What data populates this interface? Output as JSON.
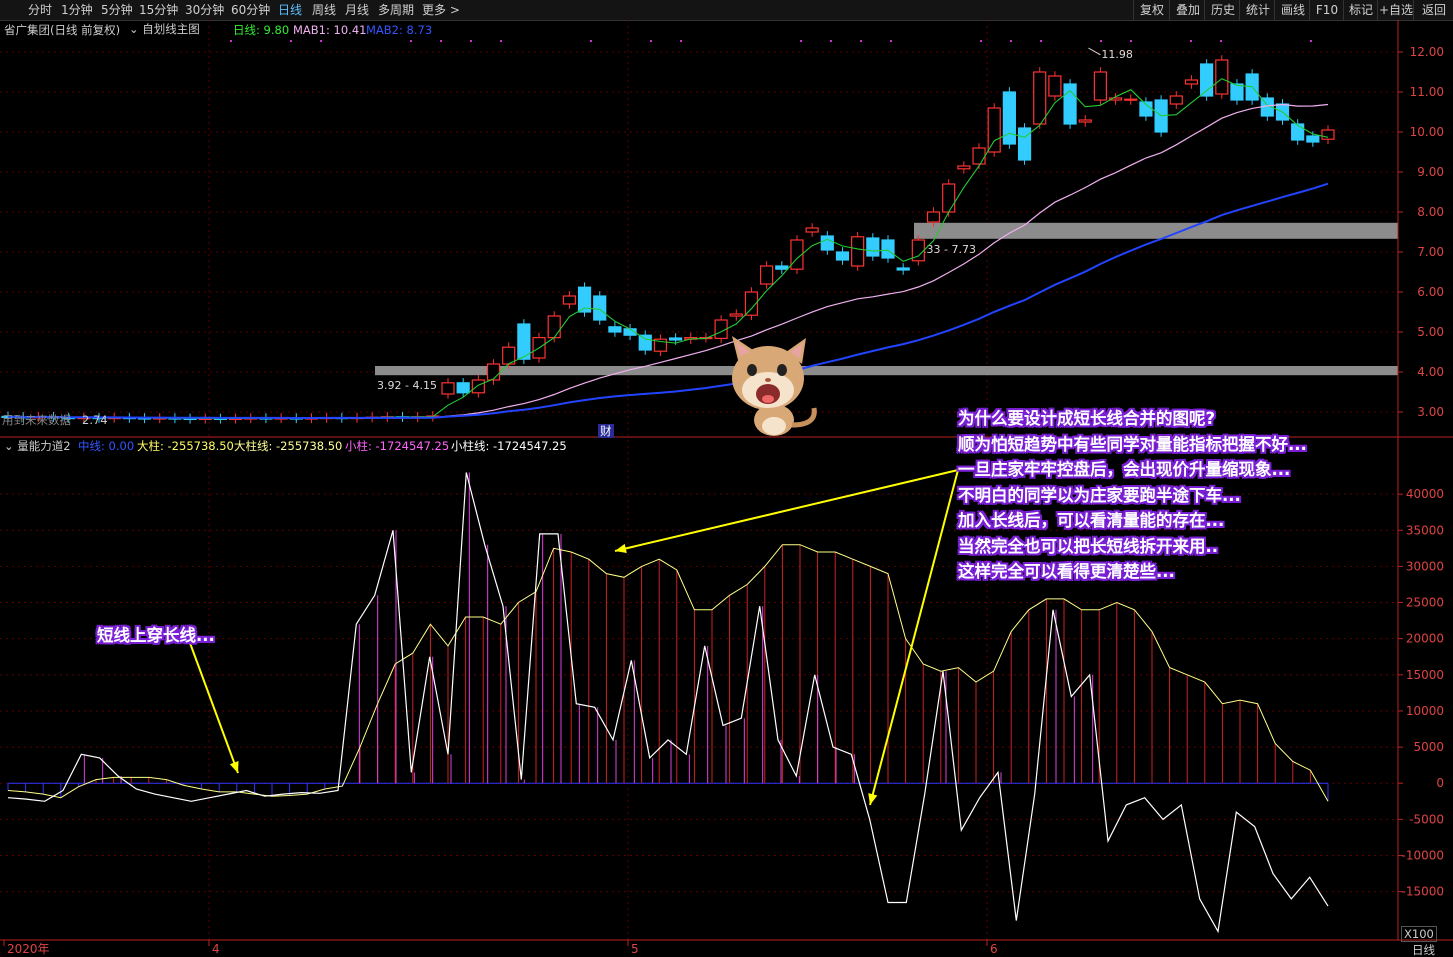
{
  "toolbar": {
    "periods": [
      "分时",
      "1分钟",
      "5分钟",
      "15分钟",
      "30分钟",
      "60分钟",
      "日线",
      "周线",
      "月线",
      "多周期",
      "更多 >"
    ],
    "active_period": "日线",
    "right_buttons": [
      "复权",
      "叠加",
      "历史",
      "统计",
      "画线",
      "F10",
      "标记",
      "+自选",
      "返回"
    ]
  },
  "main_info": {
    "stock": "省广集团(日线 前复权)",
    "formula": "自划线主图",
    "ma_label": "日线: 9.80",
    "mab1": "MAB1: 10.41",
    "mab2": "MAB2: 8.73"
  },
  "sub_info": {
    "indicator": "量能力道2",
    "mid": "中线: 0.00",
    "big_bar": "大柱: -255738.50",
    "big_bar_line": "大柱线: -255738.50",
    "small_bar": "小柱: -1724547.25",
    "small_bar_line": "小柱线: -1724547.25"
  },
  "price_axis": [
    "12.00",
    "11.00",
    "10.00",
    "9.00",
    "8.00",
    "7.00",
    "6.00",
    "5.00",
    "4.00",
    "3.00"
  ],
  "volume_axis": [
    "40000",
    "35000",
    "30000",
    "25000",
    "20000",
    "15000",
    "10000",
    "5000",
    "0",
    "-5000",
    "-10000",
    "-15000"
  ],
  "axis_unit": "X100",
  "date_axis": [
    "2020年",
    "4",
    "5",
    "6"
  ],
  "period_footer": "日线",
  "labels": {
    "high": "11.98",
    "zone1": "3.92 - 4.15",
    "zone2": "7.33 - 7.73",
    "unused": "用到未来数据",
    "low": "2.74",
    "cai": "财"
  },
  "annotation_lines": [
    "为什么要设计成短长线合并的图呢?",
    "顺为怕短趋势中有些同学对量能指标把握不好...",
    "一旦庄家牢牢控盘后，会出现价升量缩现象...",
    "不明白的同学以为庄家要跑半途下车...",
    "加入长线后，可以看清量能的存在...",
    "当然完全也可以把长短线拆开来用..",
    "这样完全可以看得更清楚些..."
  ],
  "annotation_short": "短线上穿长线...",
  "chart_data": [
    {
      "type": "candlestick",
      "title": "省广集团(日线 前复权)",
      "ylim": [
        2.6,
        12.3
      ],
      "series": [
        {
          "name": "日线",
          "color": "#22cc33"
        },
        {
          "name": "MAB1",
          "color": "#f0b0f0"
        },
        {
          "name": "MAB2",
          "color": "#2244ff"
        }
      ],
      "candles": [
        [
          2.89,
          2.88
        ],
        [
          2.88,
          2.87
        ],
        [
          2.87,
          2.88
        ],
        [
          2.88,
          2.87
        ],
        [
          2.86,
          2.85
        ],
        [
          2.85,
          2.86
        ],
        [
          2.86,
          2.85
        ],
        [
          2.85,
          2.86
        ],
        [
          2.86,
          2.85
        ],
        [
          2.85,
          2.84
        ],
        [
          2.84,
          2.85
        ],
        [
          2.85,
          2.84
        ],
        [
          2.84,
          2.83
        ],
        [
          2.83,
          2.84
        ],
        [
          2.84,
          2.83
        ],
        [
          2.83,
          2.84
        ],
        [
          2.84,
          2.85
        ],
        [
          2.85,
          2.84
        ],
        [
          2.84,
          2.85
        ],
        [
          2.85,
          2.84
        ],
        [
          2.84,
          2.85
        ],
        [
          2.85,
          2.86
        ],
        [
          2.86,
          2.85
        ],
        [
          2.85,
          2.86
        ],
        [
          2.86,
          2.87
        ],
        [
          2.87,
          2.88
        ],
        [
          2.88,
          2.87
        ],
        [
          2.87,
          2.88
        ],
        [
          2.88,
          2.9
        ],
        [
          3.45,
          3.73
        ],
        [
          3.73,
          3.48
        ],
        [
          3.48,
          3.8
        ],
        [
          3.8,
          4.2
        ],
        [
          4.2,
          4.62
        ],
        [
          5.2,
          4.32
        ],
        [
          4.35,
          4.86
        ],
        [
          4.86,
          5.4
        ],
        [
          5.7,
          5.9
        ],
        [
          6.12,
          5.5
        ],
        [
          5.9,
          5.3
        ],
        [
          5.13,
          5.0
        ],
        [
          5.08,
          4.92
        ],
        [
          4.92,
          4.55
        ],
        [
          4.52,
          4.82
        ],
        [
          4.85,
          4.8
        ],
        [
          4.82,
          4.86
        ],
        [
          4.86,
          4.86
        ],
        [
          4.84,
          5.3
        ],
        [
          5.4,
          5.45
        ],
        [
          5.42,
          6.0
        ],
        [
          6.2,
          6.65
        ],
        [
          6.65,
          6.57
        ],
        [
          6.57,
          7.3
        ],
        [
          7.5,
          7.6
        ],
        [
          7.4,
          7.05
        ],
        [
          7.0,
          6.8
        ],
        [
          6.65,
          7.38
        ],
        [
          7.35,
          6.9
        ],
        [
          7.3,
          6.85
        ],
        [
          6.6,
          6.55
        ],
        [
          6.78,
          7.3
        ],
        [
          7.75,
          8.0
        ],
        [
          8.0,
          8.7
        ],
        [
          9.08,
          9.15
        ],
        [
          9.2,
          9.6
        ],
        [
          9.5,
          10.6
        ],
        [
          11.0,
          9.7
        ],
        [
          10.1,
          9.3
        ],
        [
          10.2,
          11.5
        ],
        [
          10.9,
          11.4
        ],
        [
          11.2,
          10.2
        ],
        [
          10.25,
          10.3
        ],
        [
          10.8,
          11.5
        ],
        [
          10.8,
          10.85
        ],
        [
          10.8,
          10.82
        ],
        [
          10.75,
          10.4
        ],
        [
          10.8,
          10.0
        ],
        [
          10.7,
          10.9
        ],
        [
          11.2,
          11.3
        ],
        [
          11.7,
          10.9
        ],
        [
          10.95,
          11.8
        ],
        [
          11.2,
          10.8
        ],
        [
          11.45,
          10.8
        ],
        [
          10.85,
          10.4
        ],
        [
          10.7,
          10.3
        ],
        [
          10.2,
          9.8
        ],
        [
          9.9,
          9.75
        ],
        [
          9.82,
          10.05
        ]
      ],
      "zones": [
        {
          "label": "3.92 - 4.15",
          "low": 3.92,
          "high": 4.15
        },
        {
          "label": "7.33 - 7.73",
          "low": 7.33,
          "high": 7.73
        }
      ],
      "annotations": [
        {
          "label": "11.98",
          "value": 11.98
        }
      ]
    },
    {
      "type": "bar",
      "title": "量能力道2",
      "ylim": [
        -21000,
        45000
      ],
      "series": [
        {
          "name": "大柱线",
          "values": [
            -1000,
            -1200,
            -1500,
            -2000,
            -500,
            500,
            800,
            800,
            800,
            500,
            -300,
            -800,
            -1200,
            -1200,
            -1500,
            -1800,
            -1700,
            -1500,
            -800,
            -400,
            5000,
            11000,
            16500,
            18000,
            22000,
            19000,
            23000,
            23000,
            22000,
            25000,
            26500,
            32500,
            32000,
            31000,
            29000,
            28500,
            30000,
            31000,
            29500,
            24000,
            24000,
            26000,
            27500,
            30000,
            33000,
            33000,
            32000,
            32000,
            31000,
            30000,
            29000,
            20000,
            16500,
            15500,
            16000,
            14000,
            15500,
            21000,
            24000,
            25500,
            25500,
            24000,
            24000,
            25000,
            24000,
            21000,
            16000,
            15000,
            14000,
            11000,
            11500,
            11000,
            5500,
            3000,
            1800,
            -2500
          ]
        },
        {
          "name": "小柱线",
          "values": [
            -2000,
            -2200,
            -2500,
            -1000,
            4000,
            3500,
            1000,
            -800,
            -1500,
            -2000,
            -2500,
            -2000,
            -1500,
            -1000,
            -1800,
            -1500,
            -1300,
            -1400,
            -1000,
            22000,
            26000,
            35000,
            1500,
            17500,
            4000,
            43000,
            33000,
            24500,
            500,
            34500,
            34500,
            11000,
            10500,
            6000,
            17000,
            3500,
            6000,
            4000,
            19000,
            8000,
            9000,
            24500,
            6000,
            1000,
            15000,
            5000,
            4000,
            -5000,
            -16500,
            -16500,
            -1500,
            15500,
            -6500,
            -2000,
            1500,
            -19000,
            -1500,
            24000,
            12000,
            15000,
            -8000,
            -3000,
            -2000,
            -5000,
            -3000,
            -16000,
            -20500,
            -4000,
            -6000,
            -12500,
            -16000,
            -13000,
            -17000
          ]
        }
      ]
    }
  ]
}
